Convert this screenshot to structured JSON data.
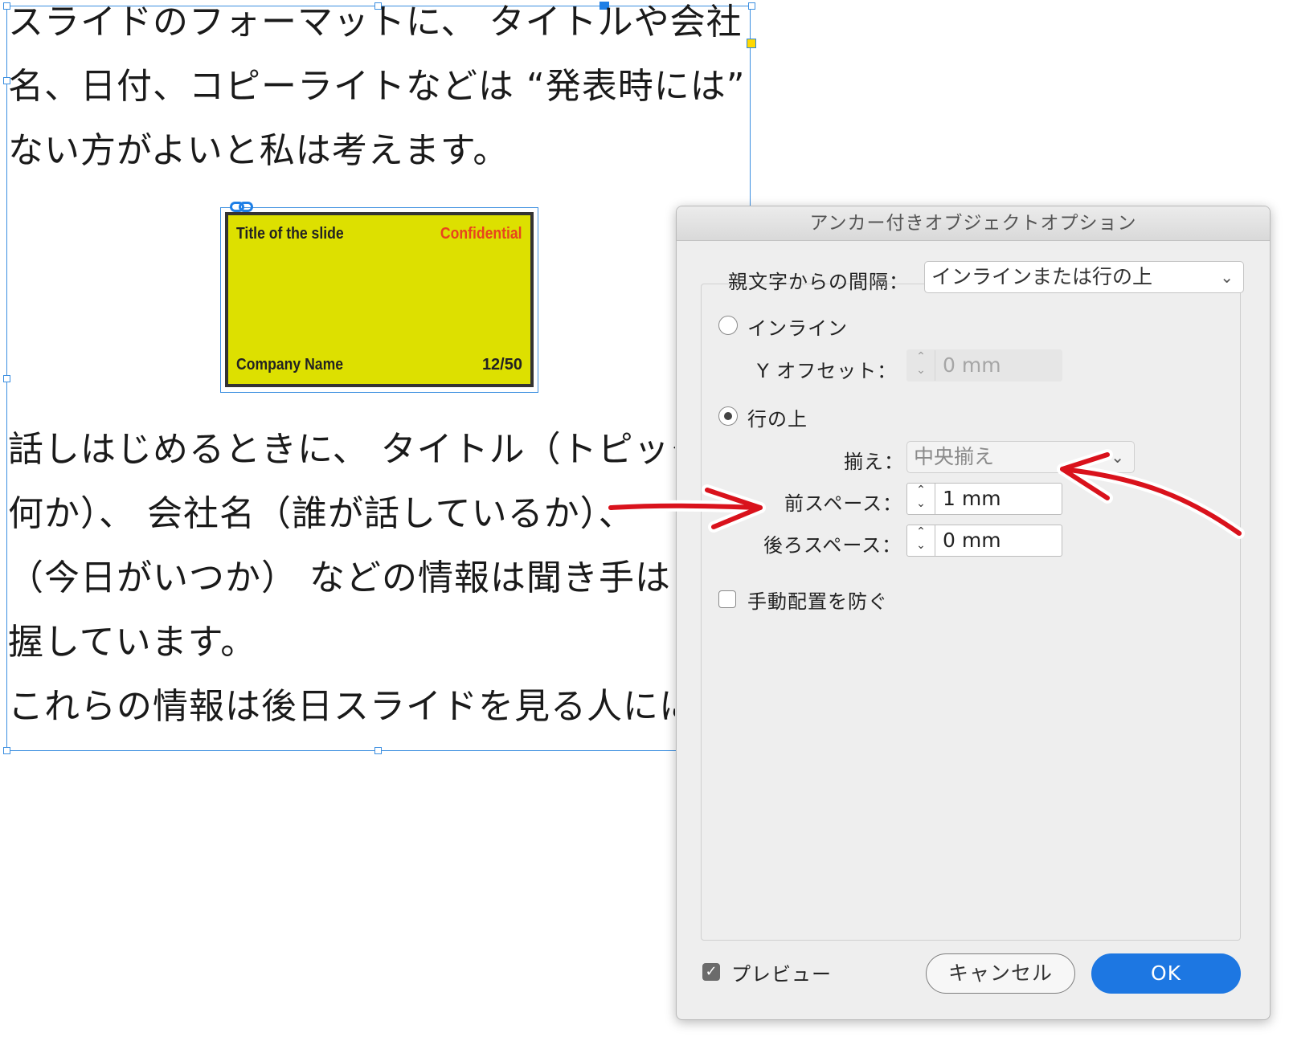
{
  "document": {
    "paragraph1_lines": [
      "スライドのフォーマットに、 タイトルや会社",
      "名、日付、コピーライトなどは “発表時には”",
      "ない方がよいと私は考えます。"
    ],
    "paragraph2_lines": [
      "話しはじめるときに、 タイトル（トピック",
      "何か）、 会社名（誰が話しているか）、",
      "（今日がいつか） などの情報は聞き手は",
      "握しています。",
      "これらの情報は後日スライドを見る人にに"
    ]
  },
  "slide": {
    "title": "Title of the slide",
    "confidential": "Confidential",
    "company": "Company Name",
    "page": "12/50",
    "bg_color": "#dde000",
    "confidential_color": "#e8441d"
  },
  "dialog": {
    "title": "アンカー付きオブジェクトオプション",
    "position_label": "親文字からの間隔：",
    "position_value": "インラインまたは行の上",
    "inline_label": "インライン",
    "y_offset_label": "Y オフセット：",
    "y_offset_value": "0 mm",
    "above_line_label": "行の上",
    "align_label": "揃え：",
    "align_value": "中央揃え",
    "space_before_label": "前スペース：",
    "space_before_value": "1 mm",
    "space_after_label": "後ろスペース：",
    "space_after_value": "0 mm",
    "prevent_manual_label": "手動配置を防ぐ",
    "preview_label": "プレビュー",
    "cancel_label": "キャンセル",
    "ok_label": "OK"
  },
  "icons": {
    "select_chevron": "chevron-down-icon",
    "spinner": "stepper-arrows-icon",
    "check": "check-icon",
    "link": "link-icon"
  },
  "colors": {
    "frame": "#3b8ee0",
    "annotation_arrow": "#d9121c",
    "ok_button": "#1d77e2"
  }
}
